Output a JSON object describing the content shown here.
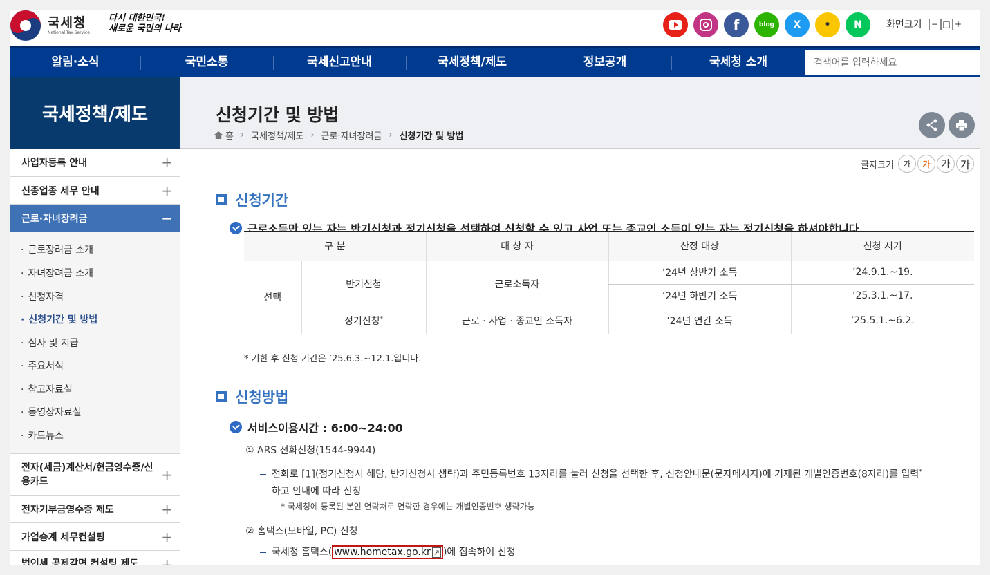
{
  "header": {
    "logo_ko": "국세청",
    "logo_en": "National Tax Service",
    "slogan_line1": "다시 대한민국!",
    "slogan_line2": "새로운 국민의 나라",
    "sns": {
      "blog": "blog",
      "x": "X",
      "kakao": "•",
      "naver": "N"
    },
    "zoom_label": "화면크기",
    "zoom_minus": "−",
    "zoom_reset": "□",
    "zoom_plus": "+"
  },
  "nav": {
    "items": [
      "알림·소식",
      "국민소통",
      "국세신고안내",
      "국세정책/제도",
      "정보공개",
      "국세청 소개"
    ],
    "search_placeholder": "검색어를 입력하세요"
  },
  "sidebar": {
    "title": "국세정책/제도",
    "items": [
      {
        "label": "사업자등록 안내",
        "sign": "+"
      },
      {
        "label": "신종업종 세무 안내",
        "sign": "+"
      },
      {
        "label": "근로·자녀장려금",
        "sign": "−"
      },
      {
        "label": "전자(세금)계산서/현금영수증/신용카드",
        "sign": "+"
      },
      {
        "label": "전자기부금영수증 제도",
        "sign": "+"
      },
      {
        "label": "가업승계 세무컨설팅",
        "sign": "+"
      },
      {
        "label": "법인세 공제감면 컨설팅 제도",
        "sign": "+"
      }
    ],
    "sub_items": [
      "근로장려금 소개",
      "자녀장려금 소개",
      "신청자격",
      "신청기간 및 방법",
      "심사 및 지급",
      "주요서식",
      "참고자료실",
      "동영상자료실",
      "카드뉴스"
    ]
  },
  "page": {
    "title": "신청기간 및 방법",
    "breadcrumb": [
      "홈",
      "국세정책/제도",
      "근로·자녀장려금",
      "신청기간 및 방법"
    ],
    "font_size_label": "글자크기",
    "font_sizes": [
      "가",
      "가",
      "가",
      "가"
    ]
  },
  "section1": {
    "heading": "신청기간",
    "subheading": "근로소득만 있는 자는 반기신청과 정기신청을 선택하여 신청할 수 있고,사업 또는 종교인 소득이 있는 자는 정기신청을 하셔야합니다.",
    "table": {
      "headers": [
        "구 분",
        "대 상 자",
        "산정 대상",
        "신청 시기"
      ],
      "group": "선택",
      "half_label": "반기신청",
      "half_target": "근로소득자",
      "rows": [
        {
          "period": "’24년 상반기 소득",
          "date": "’24.9.1.~19."
        },
        {
          "period": "’24년 하반기 소득",
          "date": "’25.3.1.~17."
        }
      ],
      "regular_label": "정기신청",
      "regular_mark": "*",
      "regular_target": "근로 · 사업 · 종교인 소득자",
      "regular_period": "’24년 연간 소득",
      "regular_date": "’25.5.1.~6.2."
    },
    "note": "* 기한 후 신청 기간은 ’25.6.3.~12.1.입니다."
  },
  "section2": {
    "heading": "신청방법",
    "service_hours": "서비스이용시간 : 6:00~24:00",
    "step1": "① ARS 전화신청(1544-9944)",
    "step1_desc_line1": "전화로 [1](정기신청시 해당, 반기신청시 생략)과 주민등록번호 13자리를 눌러 신청을 선택한 후, 신청안내문(문자메시지)에 기재된 개별인증번호(8자리)를 입력",
    "step1_desc_mark": "*",
    "step1_desc_line2": "하고 안내에 따라 신청",
    "step1_note": "* 국세청에 등록된 본인 연락처로 연락한 경우에는 개별인증번호 생략가능",
    "step2": "② 홈택스(모바일, PC) 신청",
    "step2_desc_pre": "국세청 홈택스(",
    "step2_link": "www.hometax.go.kr",
    "step2_link_icon": "↗",
    "step2_desc_post": ")에 접속하여 신청"
  }
}
